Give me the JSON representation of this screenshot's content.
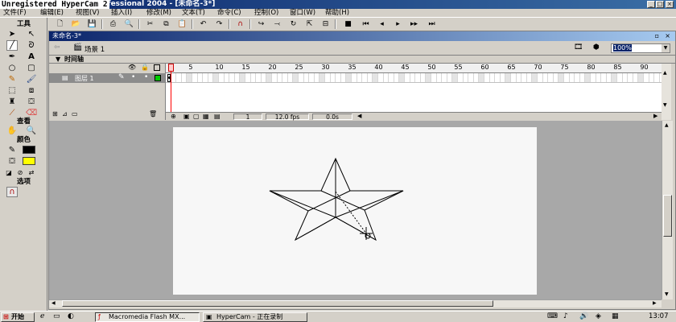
{
  "window": {
    "title": "Macromedia Flash MX Professional 2004 - [未命名-3*]",
    "watermark": "Unregistered HyperCam 2"
  },
  "menu": [
    "文件(F)",
    "编辑(E)",
    "视图(V)",
    "插入(I)",
    "修改(M)",
    "文本(T)",
    "命令(C)",
    "控制(O)",
    "窗口(W)",
    "帮助(H)"
  ],
  "tools_panel": {
    "header": "工具",
    "view_label": "查看",
    "colors_label": "颜色",
    "options_label": "选项"
  },
  "document": {
    "tab": "未命名-3*",
    "scene": "场景 1",
    "zoom": "100%"
  },
  "timeline": {
    "label": "时间轴",
    "layer_name": "图层 1",
    "frame_ticks": [
      "1",
      "5",
      "10",
      "15",
      "20",
      "25",
      "30",
      "35",
      "40",
      "45",
      "50",
      "55",
      "60",
      "65",
      "70",
      "75",
      "80",
      "85",
      "90"
    ],
    "current_frame": "1",
    "fps": "12.0 fps",
    "time": "0.0s"
  },
  "colors": {
    "fill": "#ffff00",
    "stroke": "#000000",
    "stage": "#f7f7f7",
    "playhead": "#ff0000"
  },
  "taskbar": {
    "start": "开始",
    "tasks": [
      "Macromedia Flash MX...",
      "HyperCam - 正在录制"
    ],
    "clock": "13:07"
  }
}
